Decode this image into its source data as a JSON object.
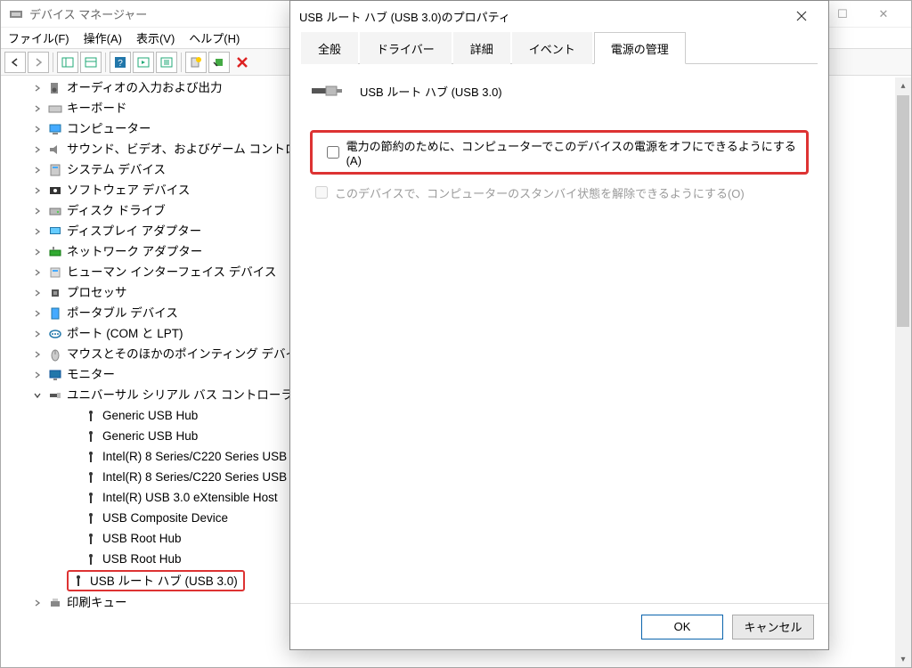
{
  "dm": {
    "title": "デバイス マネージャー",
    "menu": {
      "file": "ファイル(F)",
      "action": "操作(A)",
      "view": "表示(V)",
      "help": "ヘルプ(H)"
    },
    "tree": {
      "items": [
        {
          "label": "オーディオの入力および出力",
          "icon": "speaker"
        },
        {
          "label": "キーボード",
          "icon": "keyboard"
        },
        {
          "label": "コンピューター",
          "icon": "computer"
        },
        {
          "label": "サウンド、ビデオ、およびゲーム コントローラー",
          "icon": "sound"
        },
        {
          "label": "システム デバイス",
          "icon": "system"
        },
        {
          "label": "ソフトウェア デバイス",
          "icon": "software"
        },
        {
          "label": "ディスク ドライブ",
          "icon": "disk"
        },
        {
          "label": "ディスプレイ アダプター",
          "icon": "display"
        },
        {
          "label": "ネットワーク アダプター",
          "icon": "network"
        },
        {
          "label": "ヒューマン インターフェイス デバイス",
          "icon": "hid"
        },
        {
          "label": "プロセッサ",
          "icon": "cpu"
        },
        {
          "label": "ポータブル デバイス",
          "icon": "portable"
        },
        {
          "label": "ポート (COM と LPT)",
          "icon": "port"
        },
        {
          "label": "マウスとそのほかのポインティング デバイス",
          "icon": "mouse"
        },
        {
          "label": "モニター",
          "icon": "monitor"
        }
      ],
      "usb_group": "ユニバーサル シリアル バス コントローラー",
      "usb_children": [
        "Generic USB Hub",
        "Generic USB Hub",
        "Intel(R) 8 Series/C220 Series USB",
        "Intel(R) 8 Series/C220 Series USB",
        "Intel(R) USB 3.0 eXtensible Host",
        "USB Composite Device",
        "USB Root Hub",
        "USB Root Hub",
        "USB ルート ハブ (USB 3.0)"
      ],
      "after": "印刷キュー"
    }
  },
  "props": {
    "title": "USB ルート ハブ (USB 3.0)のプロパティ",
    "tabs": [
      "全般",
      "ドライバー",
      "詳細",
      "イベント",
      "電源の管理"
    ],
    "active_tab_index": 4,
    "device_name": "USB ルート ハブ (USB 3.0)",
    "checkbox1": "電力の節約のために、コンピューターでこのデバイスの電源をオフにできるようにする(A)",
    "checkbox2": "このデバイスで、コンピューターのスタンバイ状態を解除できるようにする(O)",
    "checkbox1_checked": false,
    "checkbox2_checked": false,
    "ok": "OK",
    "cancel": "キャンセル"
  }
}
